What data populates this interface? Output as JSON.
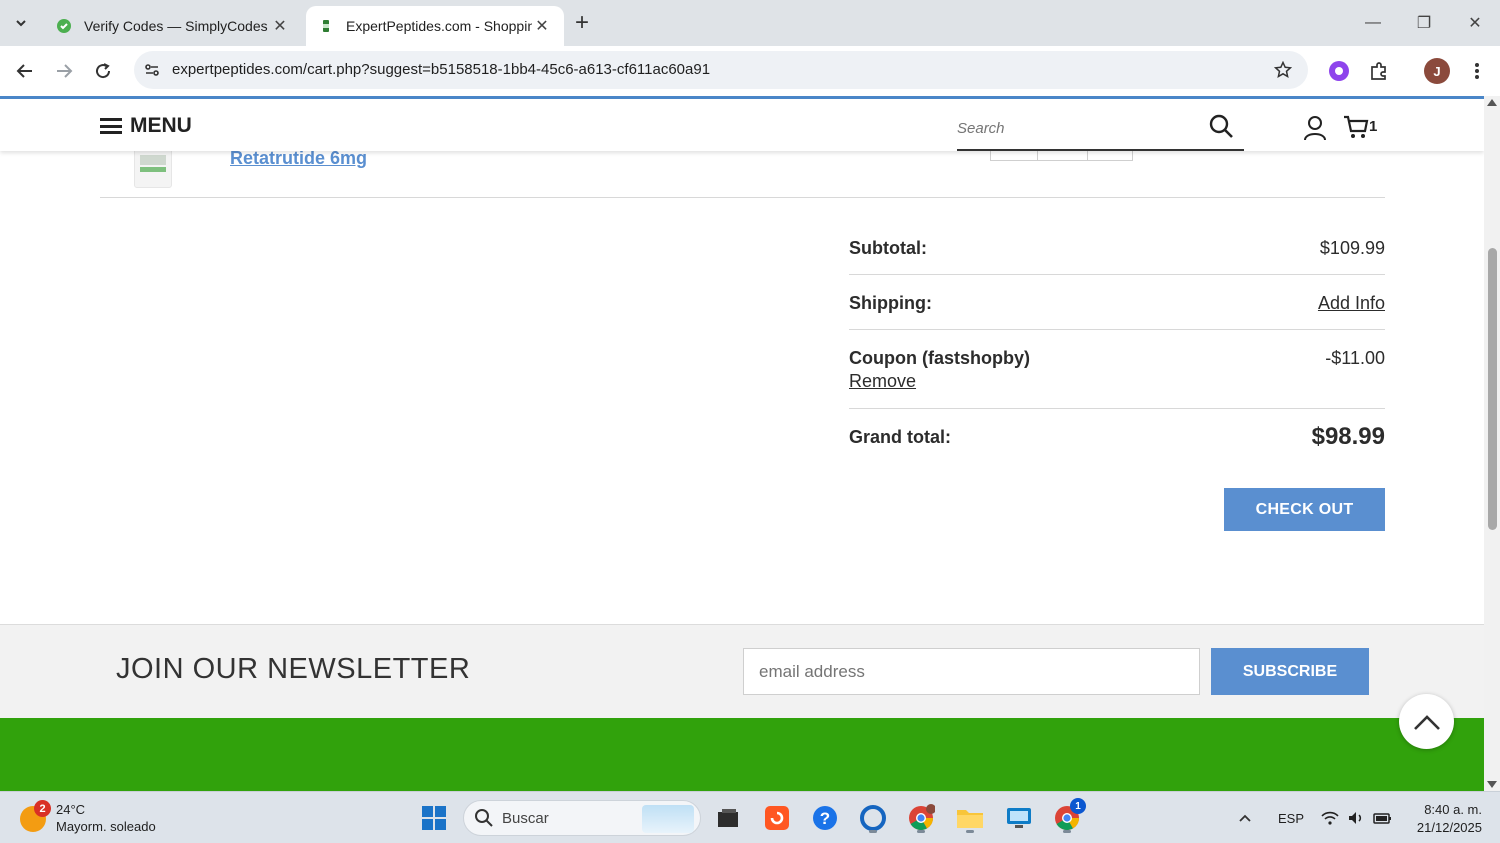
{
  "browser": {
    "tabs": [
      {
        "title": "Verify Codes — SimplyCodes",
        "active": false
      },
      {
        "title": "ExpertPeptides.com - Shopping",
        "active": true
      }
    ],
    "url": "expertpeptides.com/cart.php?suggest=b5158518-1bb4-45c6-a613-cf611ac60a91",
    "profile_initial": "J"
  },
  "site": {
    "menu_label": "MENU",
    "search_placeholder": "Search",
    "cart_count": "1"
  },
  "cart": {
    "product_name": "Retatrutide 6mg",
    "subtotal_label": "Subtotal:",
    "subtotal_value": "$109.99",
    "shipping_label": "Shipping:",
    "shipping_link": "Add Info",
    "coupon_label": "Coupon (fastshopby)",
    "coupon_value": "-$11.00",
    "coupon_remove": "Remove",
    "grand_total_label": "Grand total:",
    "grand_total_value": "$98.99",
    "checkout_label": "CHECK OUT"
  },
  "newsletter": {
    "title": "JOIN OUR NEWSLETTER",
    "email_placeholder": "email address",
    "subscribe_label": "SUBSCRIBE"
  },
  "taskbar": {
    "weather_badge": "2",
    "temperature": "24°C",
    "condition": "Mayorm. soleado",
    "search_label": "Buscar",
    "chrome_badge": "1",
    "language": "ESP",
    "time": "8:40 a. m.",
    "date": "21/12/2025"
  },
  "colors": {
    "accent_blue": "#5a8fd0",
    "footer_green": "#31a20c",
    "header_border": "#4a86c8"
  }
}
